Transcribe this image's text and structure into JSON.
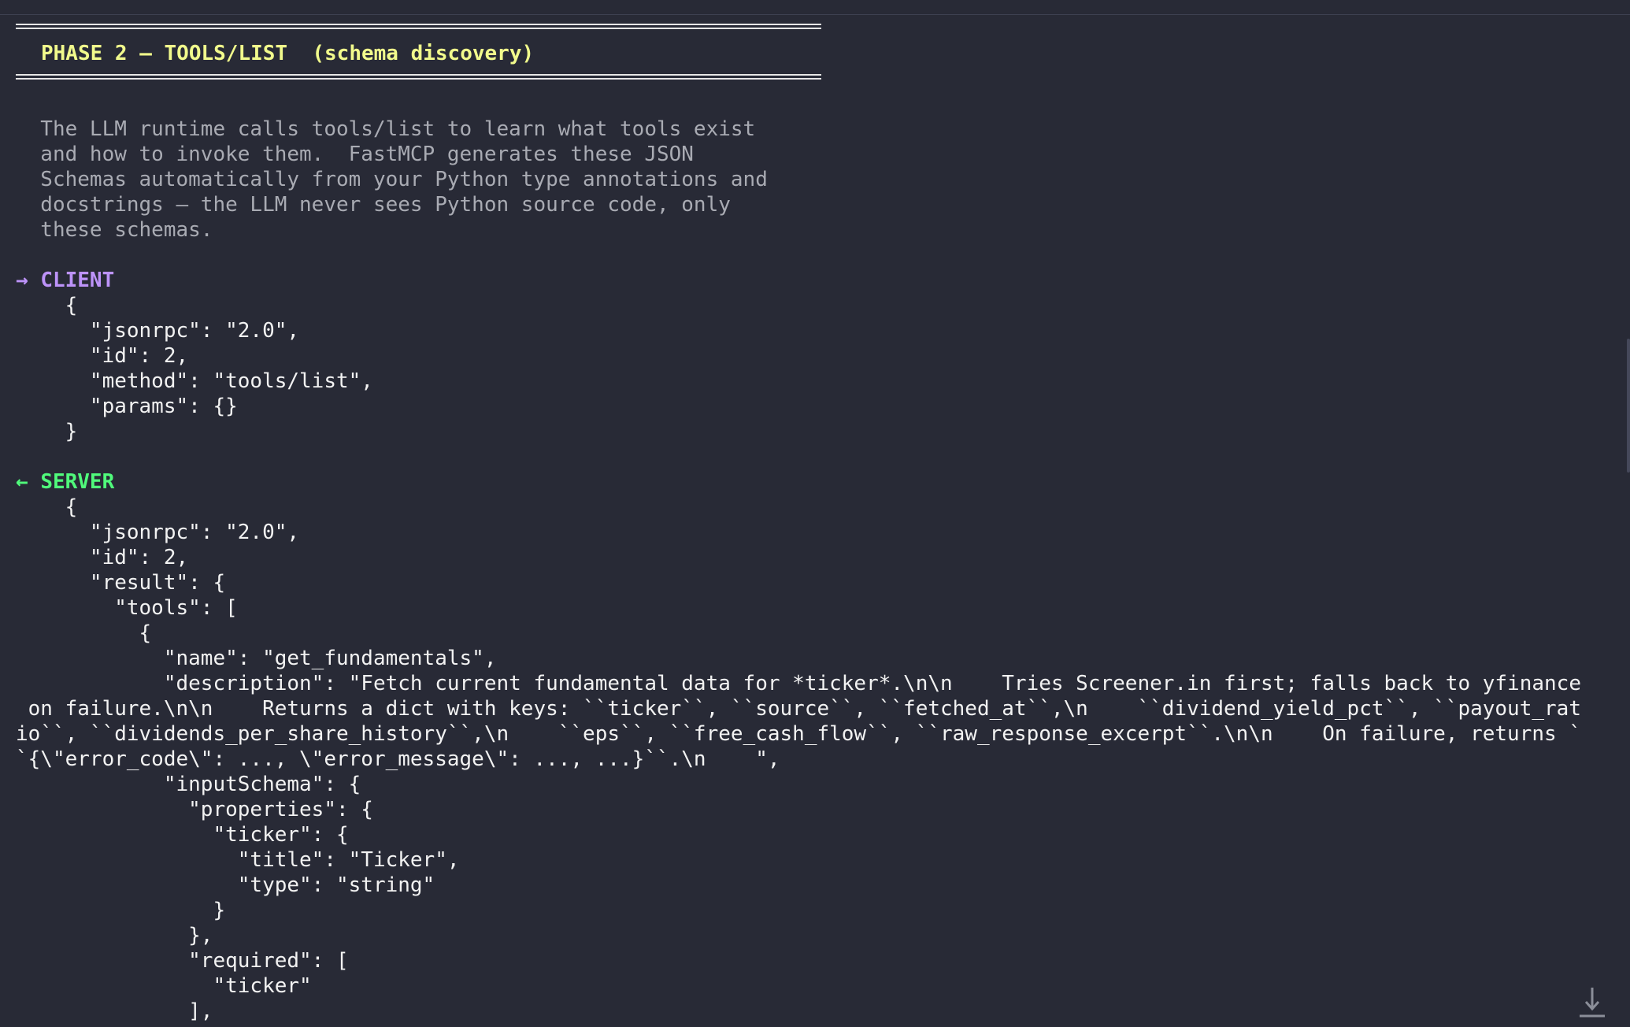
{
  "phase_title": "PHASE 2 — TOOLS/LIST  (schema discovery)",
  "description_lines": [
    "  The LLM runtime calls tools/list to learn what tools exist",
    "  and how to invoke them.  FastMCP generates these JSON",
    "  Schemas automatically from your Python type annotations and",
    "  docstrings — the LLM never sees Python source code, only",
    "  these schemas."
  ],
  "client": {
    "arrow": "→",
    "label": "CLIENT",
    "lines": [
      "    {",
      "      \"jsonrpc\": \"2.0\",",
      "      \"id\": 2,",
      "      \"method\": \"tools/list\",",
      "      \"params\": {}",
      "    }"
    ]
  },
  "server": {
    "arrow": "←",
    "label": "SERVER",
    "lines": [
      "    {",
      "      \"jsonrpc\": \"2.0\",",
      "      \"id\": 2,",
      "      \"result\": {",
      "        \"tools\": [",
      "          {",
      "            \"name\": \"get_fundamentals\",",
      "            \"description\": \"Fetch current fundamental data for *ticker*.\\n\\n    Tries Screener.in first; falls back to yfinance",
      " on failure.\\n\\n    Returns a dict with keys: ``ticker``, ``source``, ``fetched_at``,\\n    ``dividend_yield_pct``, ``payout_rat",
      "io``, ``dividends_per_share_history``,\\n    ``eps``, ``free_cash_flow``, ``raw_response_excerpt``.\\n\\n    On failure, returns `",
      "`{\\\"error_code\\\": ..., \\\"error_message\\\": ..., ...}``.\\n    \",",
      "            \"inputSchema\": {",
      "              \"properties\": {",
      "                \"ticker\": {",
      "                  \"title\": \"Ticker\",",
      "                  \"type\": \"string\"",
      "                }",
      "              },",
      "              \"required\": [",
      "                \"ticker\"",
      "              ],"
    ]
  },
  "scroll_to_bottom_icon": "arrow-down-to-line-icon"
}
